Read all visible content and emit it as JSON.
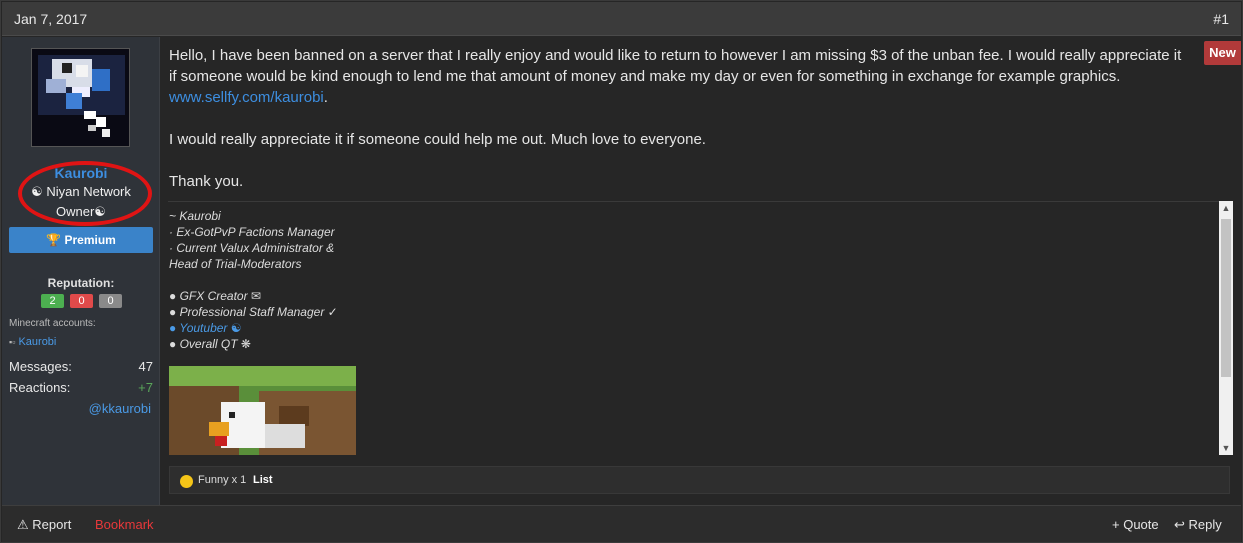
{
  "post": {
    "date": "Jan 7, 2017",
    "number": "#1",
    "new_badge": "New"
  },
  "author": {
    "username": "Kaurobi",
    "title_line1": "☯ Niyan Network",
    "title_line2": "Owner☯",
    "premium_label": "Premium",
    "reputation_label": "Reputation:",
    "rep_positive": "2",
    "rep_negative": "0",
    "rep_neutral": "0",
    "minecraft_label": "Minecraft accounts:",
    "minecraft_account": "Kaurobi",
    "messages_label": "Messages:",
    "messages_value": "47",
    "reactions_label": "Reactions:",
    "reactions_value": "+7",
    "handle": "@kkaurobi"
  },
  "message": {
    "p1_text": "Hello, I have been banned on a server that I really enjoy and would like to return to however I am missing $3 of the unban fee. I would really appreciate it if someone would be kind enough to lend me that amount of money and make my day or even for something in exchange for example graphics. ",
    "p1_link": "www.sellfy.com/kaurobi",
    "p1_end": ".",
    "p2": "I would really appreciate it if someone could help me out. Much love to everyone.",
    "p3": "Thank you."
  },
  "signature": {
    "lines": [
      "~ Kaurobi",
      "· Ex-GotPvP Factions Manager",
      "· Current Valux Administrator &",
      "Head of Trial-Moderators",
      "",
      "● GFX Creator ✉",
      "● Professional Staff Manager ✓",
      "● Youtuber ☯",
      "● Overall QT ❋"
    ]
  },
  "reactions_bar": {
    "summary": "Funny x 1",
    "list_label": "List"
  },
  "footer": {
    "report": "Report",
    "bookmark": "Bookmark",
    "quote": "+ Quote",
    "reply": "Reply"
  },
  "colors": {
    "accent": "#3d8ee0",
    "premium": "#3a83c9",
    "new_badge": "#b23a3a",
    "bookmark": "#e8383a",
    "rep_positive": "#4caf50",
    "rep_negative": "#e04a4a",
    "rep_neutral": "#8a8a8a"
  }
}
